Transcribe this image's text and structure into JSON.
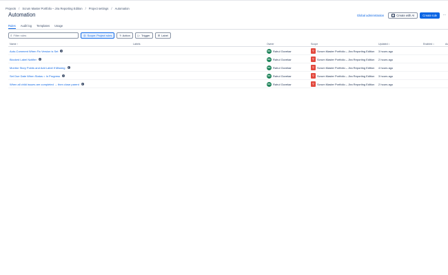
{
  "breadcrumb": [
    "Projects",
    "Scrum Master Portfolio – Jira Reporting Edition",
    "Project settings",
    "Automation"
  ],
  "page_title": "Automation",
  "header_actions": {
    "global_admin": "Global administration",
    "create_with_ai": "Create with AI",
    "create_rule": "Create rule",
    "more": "⋯"
  },
  "tabs": [
    {
      "label": "Rules",
      "active": true
    },
    {
      "label": "Audit log",
      "active": false
    },
    {
      "label": "Templates",
      "active": false
    },
    {
      "label": "Usage",
      "active": false
    }
  ],
  "filters": {
    "search_placeholder": "Filter rules",
    "scope": "Scope: Project rules",
    "action": "Action",
    "trigger": "Trigger",
    "label": "Label"
  },
  "columns": {
    "name": "Name ↑",
    "labels": "Labels",
    "owner": "Owner",
    "scope": "Scope",
    "updated": "Updated ↕",
    "enabled": "Enabled ↕",
    "actions": "Ac"
  },
  "rows": [
    {
      "name": "Auto-Comment When Fix Version is Set",
      "owner": "Rahul Govekar",
      "avatar": "RG",
      "scope": "Scrum Master Portfolio – Jira Reporting Edition",
      "updated": "3 hours ago",
      "enabled": true
    },
    {
      "name": "Blocked Label Notifier",
      "owner": "Rahul Govekar",
      "avatar": "RG",
      "scope": "Scrum Master Portfolio – Jira Reporting Edition",
      "updated": "2 hours ago",
      "enabled": true
    },
    {
      "name": "Monitor Story Points and Add Label if Missing",
      "owner": "Rahul Govekar",
      "avatar": "RG",
      "scope": "Scrum Master Portfolio – Jira Reporting Edition",
      "updated": "4 hours ago",
      "enabled": true
    },
    {
      "name": "Set Due Date When Status = In Progress",
      "owner": "Rahul Govekar",
      "avatar": "RG",
      "scope": "Scrum Master Portfolio – Jira Reporting Edition",
      "updated": "3 hours ago",
      "enabled": true
    },
    {
      "name": "When all child issues are completed → then close parent",
      "owner": "Rahul Govekar",
      "avatar": "RG",
      "scope": "Scrum Master Portfolio – Jira Reporting Edition",
      "updated": "2 hours ago",
      "enabled": true
    }
  ],
  "colors": {
    "accent": "#0c66e4",
    "toggle_on": "#22a06b",
    "avatar": "#1f845a",
    "project_icon": "#e2483d"
  }
}
